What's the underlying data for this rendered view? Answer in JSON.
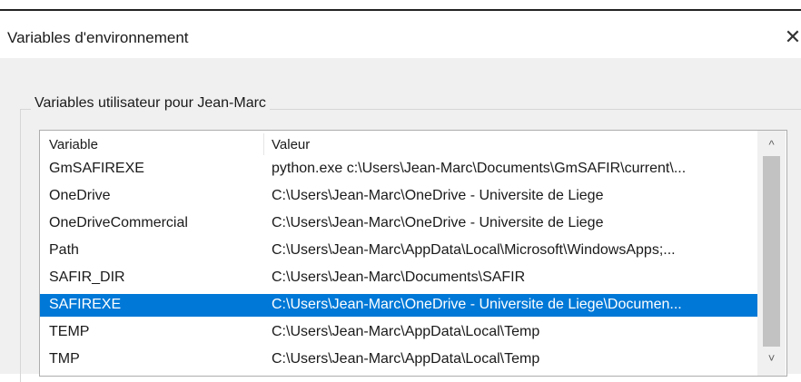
{
  "window": {
    "title": "Variables d'environnement",
    "close_glyph": "✕"
  },
  "user_vars": {
    "group_label": "Variables utilisateur pour Jean-Marc",
    "columns": [
      "Variable",
      "Valeur"
    ],
    "rows": [
      {
        "name": "GmSAFIREXE",
        "value": "python.exe c:\\Users\\Jean-Marc\\Documents\\GmSAFIR\\current\\..."
      },
      {
        "name": "OneDrive",
        "value": "C:\\Users\\Jean-Marc\\OneDrive - Universite de Liege"
      },
      {
        "name": "OneDriveCommercial",
        "value": "C:\\Users\\Jean-Marc\\OneDrive - Universite de Liege"
      },
      {
        "name": "Path",
        "value": "C:\\Users\\Jean-Marc\\AppData\\Local\\Microsoft\\WindowsApps;..."
      },
      {
        "name": "SAFIR_DIR",
        "value": "C:\\Users\\Jean-Marc\\Documents\\SAFIR"
      },
      {
        "name": "SAFIREXE",
        "value": "C:\\Users\\Jean-Marc\\OneDrive - Universite de Liege\\Documen...",
        "selected": true
      },
      {
        "name": "TEMP",
        "value": "C:\\Users\\Jean-Marc\\AppData\\Local\\Temp"
      },
      {
        "name": "TMP",
        "value": "C:\\Users\\Jean-Marc\\AppData\\Local\\Temp"
      }
    ]
  },
  "scrollbar": {
    "up_glyph": "^",
    "down_glyph": "˅"
  },
  "colors": {
    "selection": "#0078d7",
    "dialog_bg": "#f0f0f0"
  }
}
